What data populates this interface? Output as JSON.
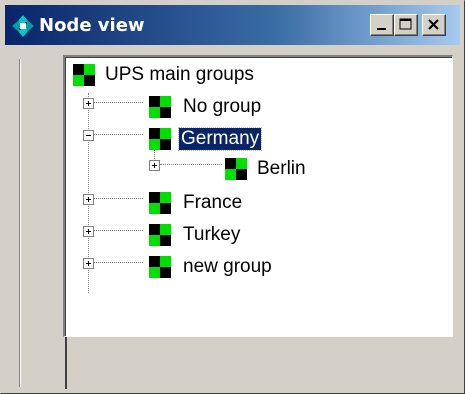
{
  "window": {
    "title": "Node view",
    "icon": "diamond-arrows-icon",
    "buttons": {
      "minimize": "minimize-icon",
      "maximize": "maximize-icon",
      "close": "close-icon"
    }
  },
  "tree": {
    "root": {
      "label": "UPS main groups",
      "icon": "node-group-icon"
    },
    "items": [
      {
        "label": "No group",
        "expander": "+",
        "icon": "node-group-icon",
        "selected": false
      },
      {
        "label": "Germany",
        "expander": "-",
        "icon": "node-group-icon",
        "selected": true
      },
      {
        "label": "Berlin",
        "expander": "+",
        "icon": "node-group-icon",
        "selected": false
      },
      {
        "label": "France",
        "expander": "+",
        "icon": "node-group-icon",
        "selected": false
      },
      {
        "label": "Turkey",
        "expander": "+",
        "icon": "node-group-icon",
        "selected": false
      },
      {
        "label": "new group",
        "expander": "+",
        "icon": "node-group-icon",
        "selected": false
      }
    ]
  },
  "colors": {
    "titlebar_start": "#0a246a",
    "titlebar_end": "#a6caf0",
    "selection": "#0a246a",
    "node_icon_green": "#00e000",
    "node_icon_black": "#000000"
  }
}
